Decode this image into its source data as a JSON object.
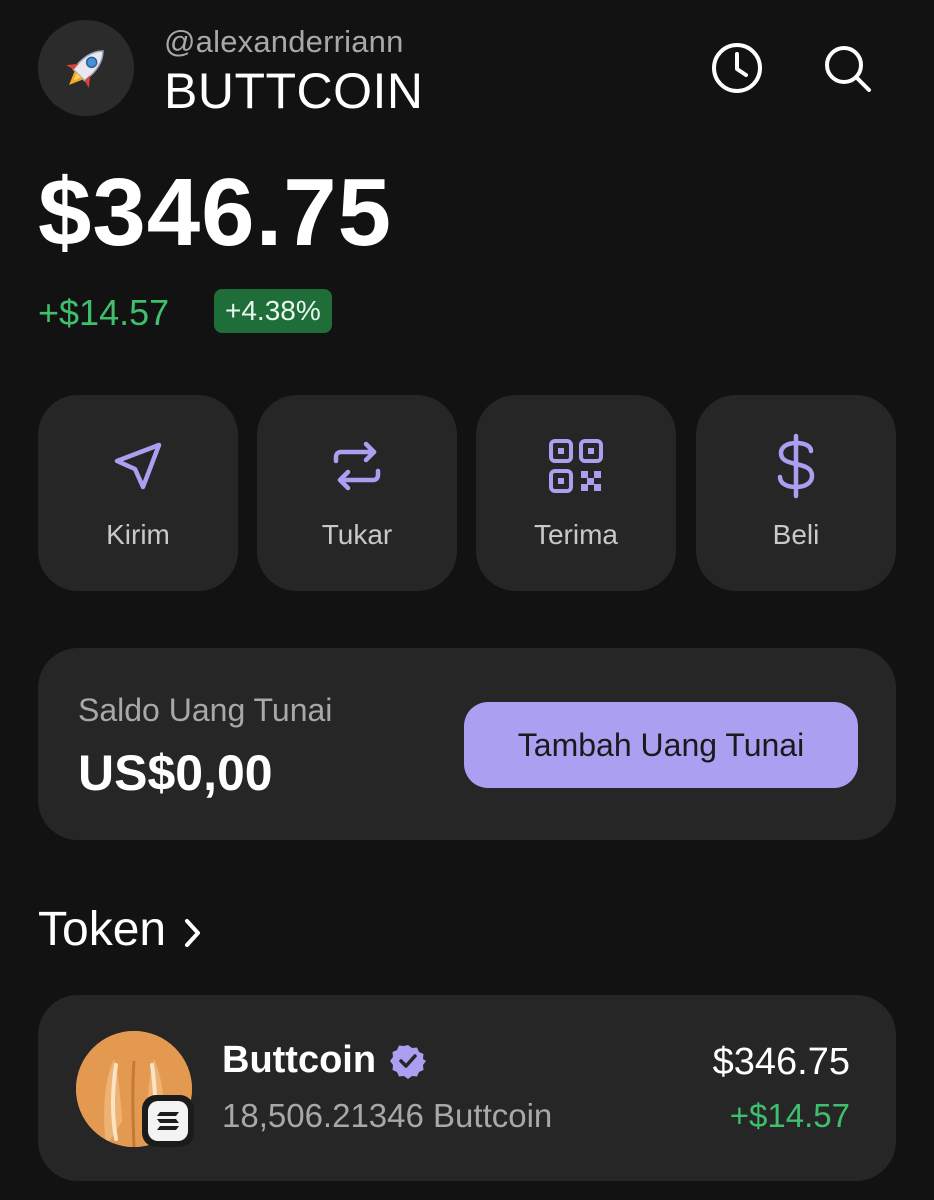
{
  "header": {
    "avatar_icon": "rocket-icon",
    "handle": "@alexanderriann",
    "wallet_name": "BUTTCOIN",
    "history_icon": "clock-icon",
    "search_icon": "search-icon"
  },
  "portfolio": {
    "balance": "$346.75",
    "change_amount": "+$14.57",
    "change_percent": "+4.38%"
  },
  "actions": [
    {
      "label": "Kirim",
      "icon": "send-icon"
    },
    {
      "label": "Tukar",
      "icon": "swap-icon"
    },
    {
      "label": "Terima",
      "icon": "qr-code-icon"
    },
    {
      "label": "Beli",
      "icon": "dollar-icon"
    }
  ],
  "cash": {
    "label": "Saldo Uang Tunai",
    "value": "US$0,00",
    "button_label": "Tambah Uang Tunai"
  },
  "tokens_section": {
    "title": "Token",
    "items": [
      {
        "name": "Buttcoin",
        "quantity": "18,506.21346 Buttcoin",
        "value": "$346.75",
        "change": "+$14.57",
        "verified": true,
        "chain_icon": "solana-icon"
      }
    ]
  },
  "colors": {
    "background": "#121212",
    "card": "#262626",
    "accent": "#ab9ff2",
    "positive": "#3fbf6d",
    "positive_badge": "#1f6e3a"
  }
}
